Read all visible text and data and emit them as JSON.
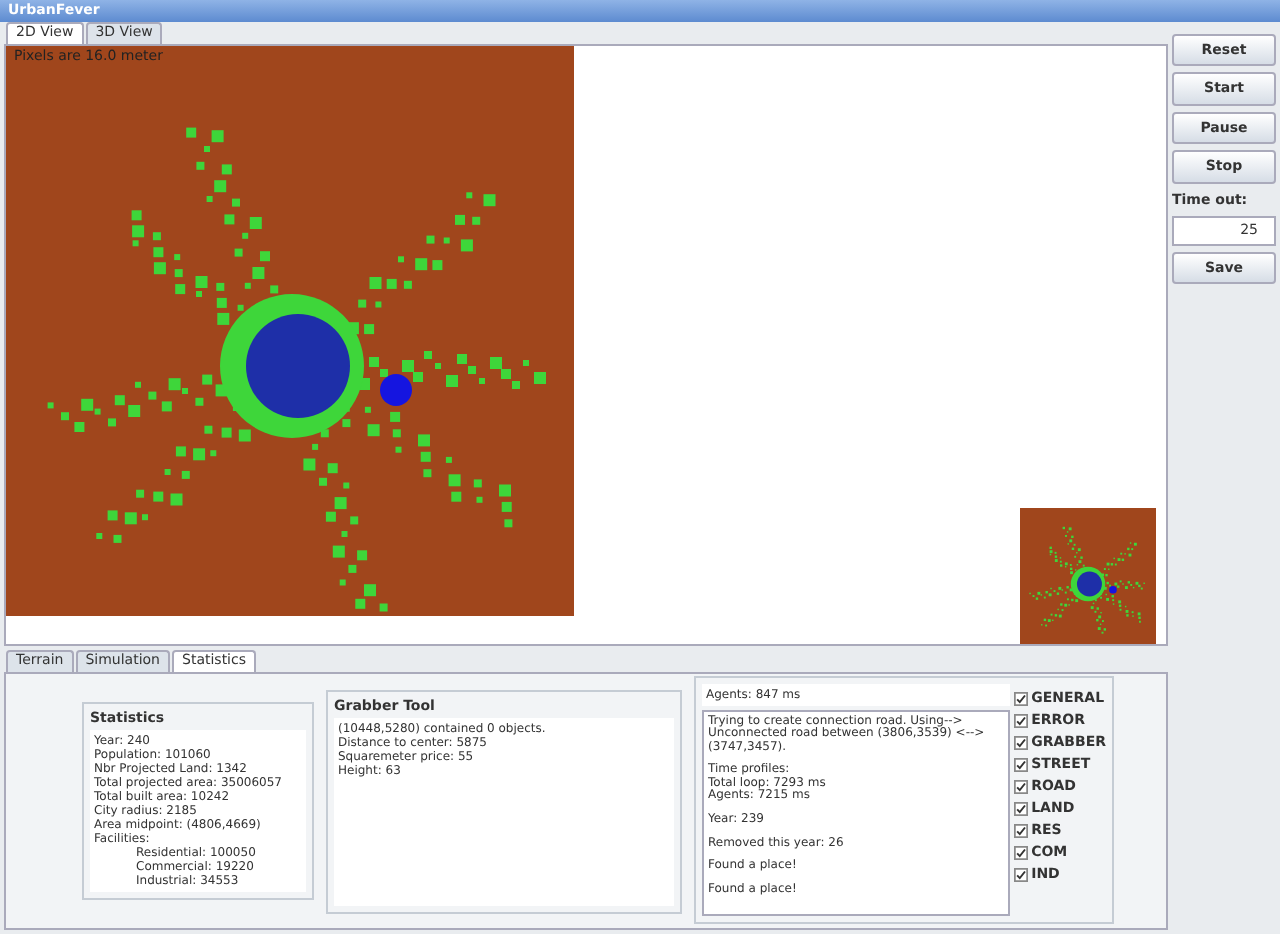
{
  "window": {
    "title": "UrbanFever"
  },
  "view_tabs": [
    {
      "label": "2D View",
      "selected": true
    },
    {
      "label": "3D View",
      "selected": false
    }
  ],
  "map": {
    "caption": "Pixels are 16.0 meter"
  },
  "controls": {
    "buttons": [
      "Reset",
      "Start",
      "Pause",
      "Stop"
    ],
    "timeout_label": "Time out:",
    "timeout_value": "25",
    "save": "Save"
  },
  "bottom_tabs": [
    {
      "label": "Terrain",
      "selected": false
    },
    {
      "label": "Simulation",
      "selected": false
    },
    {
      "label": "Statistics",
      "selected": true
    }
  ],
  "statistics": {
    "title": "Statistics",
    "lines": [
      "Year: 240",
      "Population: 101060",
      "Nbr Projected Land: 1342",
      "Total projected area: 35006057",
      "Total built area: 10242",
      "City radius: 2185",
      "Area midpoint: (4806,4669)",
      "Facilities:"
    ],
    "facilities": [
      "Residential: 100050",
      "Commercial: 19220",
      "Industrial: 34553"
    ]
  },
  "grabber": {
    "title": "Grabber Tool",
    "lines": [
      "(10448,5280) contained 0 objects.",
      "Distance to center: 5875",
      "Squaremeter price: 55",
      "Height: 63"
    ]
  },
  "log": {
    "header": "Agents: 847 ms",
    "entries": [
      [
        "Trying to create connection road. Using-->",
        "Unconnected road between (3806,3539) <-->",
        "(3747,3457)."
      ],
      [
        "Time profiles:",
        "Total loop: 7293 ms",
        "Agents: 7215 ms"
      ],
      [
        "Year: 239"
      ],
      [
        "Removed this year: 26"
      ],
      [
        "Found a place!"
      ],
      [
        "Found a place!"
      ]
    ]
  },
  "filters": [
    {
      "label": "GENERAL",
      "checked": true
    },
    {
      "label": "ERROR",
      "checked": true
    },
    {
      "label": "GRABBER",
      "checked": true
    },
    {
      "label": "STREET",
      "checked": true
    },
    {
      "label": "ROAD",
      "checked": true
    },
    {
      "label": "LAND",
      "checked": true
    },
    {
      "label": "RES",
      "checked": true
    },
    {
      "label": "COM",
      "checked": true
    },
    {
      "label": "IND",
      "checked": true
    }
  ]
}
